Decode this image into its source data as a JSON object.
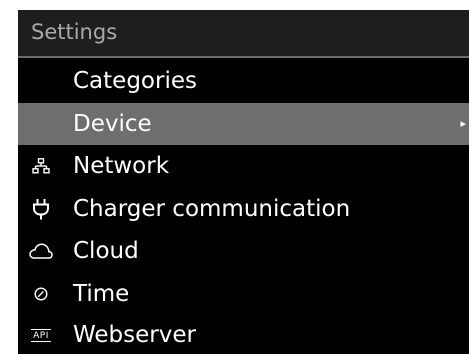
{
  "title": "Settings",
  "menu": {
    "header": "Categories",
    "items": [
      {
        "label": "Device",
        "icon": "",
        "selected": true,
        "submenu_arrow": "▸"
      },
      {
        "label": "Network",
        "icon": "network-icon"
      },
      {
        "label": "Charger communication",
        "icon": "plug-icon"
      },
      {
        "label": "Cloud",
        "icon": "cloud-icon"
      },
      {
        "label": "Time",
        "icon": "clock-icon"
      },
      {
        "label": "Webserver",
        "icon": "api-icon",
        "icon_text": "API"
      }
    ]
  },
  "colors": {
    "screen_bg": "#000000",
    "title_bg": "#1e1e1e",
    "title_text": "#a9a9a9",
    "selected_bg": "#6e6e6e",
    "text": "#ffffff"
  }
}
